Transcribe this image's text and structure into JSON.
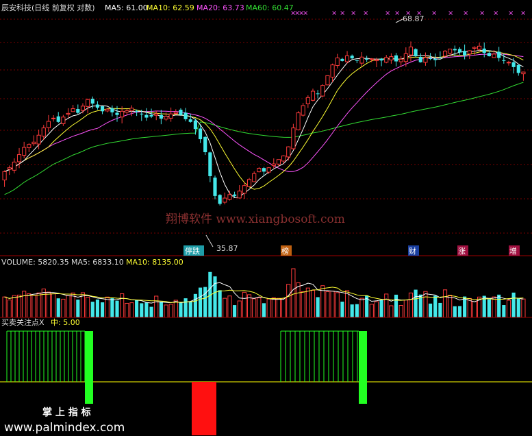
{
  "header": {
    "stock_title": "辰安科技(日线 前复权 对数)",
    "ma5": "MA5: 61.00",
    "ma10": "MA10: 62.59",
    "ma20": "MA20: 63.73",
    "ma60": "MA60: 60.47"
  },
  "price_annotations": {
    "high": "68.87",
    "low": "35.87"
  },
  "watermark": "翔博软件 www.xiangbosoft.com",
  "event_markers": [
    "停跌",
    "榜",
    "财",
    "涨",
    "增"
  ],
  "volume_header": {
    "volume": "VOLUME: 5820.35",
    "ma5": "MA5: 6833.10",
    "ma10": "MA10: 8135.00"
  },
  "indicator_header": {
    "name": "买卖关注点X",
    "mid": "中: 5.00"
  },
  "footer": {
    "caption": "掌 上 指 标",
    "site": "www.palmindex.com"
  },
  "colors": {
    "up": "#ff3b3b",
    "down": "#44e8ea",
    "ma5": "#ffffff",
    "ma10": "#ffff33",
    "ma20": "#ff55ff",
    "ma60": "#33dd33",
    "grid": "#7a0000",
    "indicator_bull": "#22ff22",
    "indicator_bear": "#ff1010",
    "indicator_mid": "#ffff00"
  },
  "chart_data": [
    {
      "type": "candlestick",
      "title": "辰安科技(日线 前复权 对数)",
      "scale": "log",
      "grid": true,
      "series": [
        {
          "name": "MA5",
          "last": 61.0
        },
        {
          "name": "MA10",
          "last": 62.59
        },
        {
          "name": "MA20",
          "last": 63.73
        },
        {
          "name": "MA60",
          "last": 60.47
        }
      ],
      "annotations": [
        {
          "text": "68.87",
          "kind": "period-high"
        },
        {
          "text": "35.87",
          "kind": "period-low"
        }
      ],
      "ylim": [
        33,
        75
      ],
      "close": [
        42.5,
        43.1,
        44.0,
        45.2,
        46.4,
        46.9,
        47.3,
        48.5,
        49.8,
        51.0,
        51.6,
        50.9,
        51.8,
        52.5,
        53.4,
        52.6,
        53.9,
        55.2,
        54.4,
        53.6,
        52.9,
        53.3,
        52.7,
        52.2,
        52.9,
        53.0,
        53.5,
        52.8,
        52.3,
        51.7,
        51.9,
        52.4,
        51.5,
        51.9,
        52.4,
        52.7,
        52.2,
        51.4,
        50.9,
        49.6,
        47.8,
        45.6,
        41.8,
        38.9,
        37.8,
        38.6,
        39.1,
        38.9,
        39.6,
        40.4,
        41.3,
        42.2,
        43.0,
        42.5,
        43.1,
        43.7,
        44.4,
        45.0,
        46.5,
        49.8,
        52.6,
        54.0,
        55.6,
        56.9,
        56.4,
        58.1,
        60.2,
        62.6,
        64.2,
        63.5,
        64.7,
        64.1,
        63.6,
        64.4,
        63.8,
        64.0,
        63.8,
        63.6,
        64.3,
        64.5,
        63.4,
        63.9,
        65.2,
        66.8,
        64.6,
        63.2,
        64.3,
        64.1,
        63.7,
        64.2,
        65.8,
        66.3,
        66.0,
        65.5,
        64.8,
        65.9,
        66.7,
        67.0,
        65.4,
        64.6,
        65.1,
        64.2,
        63.6,
        63.2,
        62.1,
        60.8,
        61.0
      ]
    },
    {
      "type": "bar",
      "title": "VOLUME",
      "values_summary": {
        "VOLUME": 5820.35,
        "MA5": 6833.1,
        "MA10": 8135.0
      }
    },
    {
      "type": "bar",
      "title": "买卖关注点X",
      "mid": 5.0
    }
  ]
}
